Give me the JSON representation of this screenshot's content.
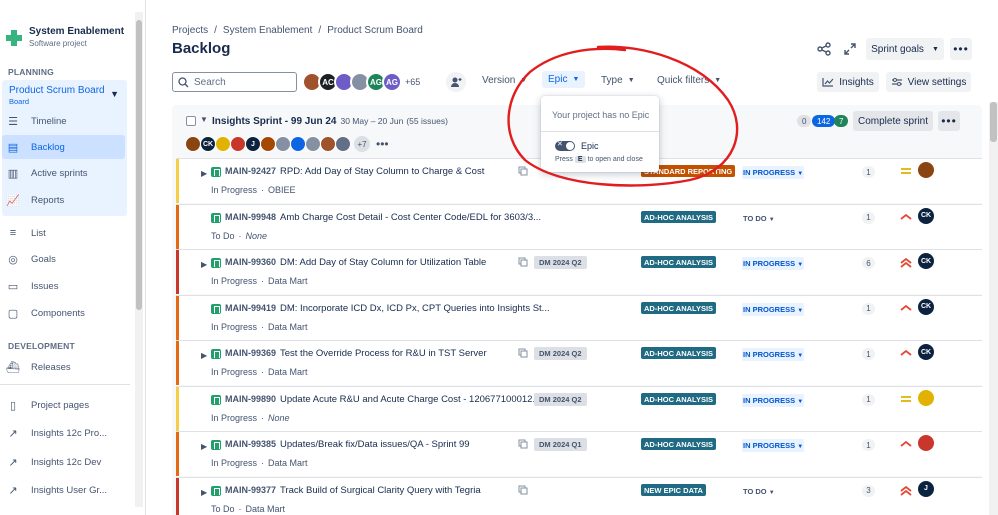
{
  "project": {
    "name": "System Enablement",
    "type": "Software project"
  },
  "sidebar": {
    "planning_heading": "PLANNING",
    "board": {
      "name": "Product Scrum Board",
      "sub": "Board"
    },
    "planning_items": [
      {
        "label": "Timeline",
        "icon": "timeline-icon"
      },
      {
        "label": "Backlog",
        "icon": "backlog-icon",
        "active": true
      },
      {
        "label": "Active sprints",
        "icon": "board-icon"
      },
      {
        "label": "Reports",
        "icon": "reports-icon"
      }
    ],
    "other_items": [
      {
        "label": "List",
        "icon": "list-icon"
      },
      {
        "label": "Goals",
        "icon": "goals-icon"
      },
      {
        "label": "Issues",
        "icon": "issues-icon"
      },
      {
        "label": "Components",
        "icon": "components-icon"
      }
    ],
    "development_heading": "DEVELOPMENT",
    "dev_items": [
      {
        "label": "Releases",
        "icon": "ship-icon"
      }
    ],
    "bottom_items": [
      {
        "label": "Project pages",
        "icon": "page-icon"
      },
      {
        "label": "Insights 12c Pro...",
        "icon": "external-link-icon"
      },
      {
        "label": "Insights 12c Dev",
        "icon": "external-link-icon"
      },
      {
        "label": "Insights User Gr...",
        "icon": "external-link-icon"
      }
    ]
  },
  "breadcrumbs": [
    "Projects",
    "System Enablement",
    "Product Scrum Board"
  ],
  "page_title": "Backlog",
  "header_buttons": {
    "sprint_goals": "Sprint goals"
  },
  "toolbar": {
    "search_placeholder": "Search",
    "avatars": [
      {
        "initials": "",
        "color": "#a0522d"
      },
      {
        "initials": "AC",
        "color": "#1d2125"
      },
      {
        "initials": "",
        "color": "#6e5dc6"
      },
      {
        "initials": "",
        "color": "#8590a2"
      },
      {
        "initials": "AG",
        "color": "#1f845a"
      },
      {
        "initials": "AG",
        "color": "#6e5dc6"
      }
    ],
    "avatar_overflow": "+65",
    "filters": [
      "Version",
      "Epic",
      "Type",
      "Quick filters"
    ],
    "insights": "Insights",
    "view_settings": "View settings"
  },
  "sprint": {
    "name": "Insights Sprint - 99 Jun 24",
    "dates": "30 May – 20 Jun",
    "count": "(55 issues)",
    "todo": "0",
    "in_progress": "142",
    "done": "7",
    "complete_label": "Complete sprint",
    "assignee_overflow": "+7",
    "assignees": [
      {
        "i": "",
        "c": "#8b4513"
      },
      {
        "i": "CK",
        "c": "#0c2340"
      },
      {
        "i": "",
        "c": "#e2b203"
      },
      {
        "i": "",
        "c": "#c9372c"
      },
      {
        "i": "J",
        "c": "#0c2340"
      },
      {
        "i": "",
        "c": "#a54800"
      },
      {
        "i": "",
        "c": "#8590a2"
      },
      {
        "i": "",
        "c": "#0c66e4"
      },
      {
        "i": "",
        "c": "#8590a2"
      },
      {
        "i": "",
        "c": "#a0522d"
      },
      {
        "i": "",
        "c": "#626f86"
      }
    ]
  },
  "issues": [
    {
      "key": "MAIN-92427",
      "summary": "RPD: Add Day of Stay Column to Charge & Cost",
      "status_label": "In Progress",
      "sub_label": "OBIEE",
      "italic": false,
      "expand": true,
      "child": true,
      "fix": "",
      "epic": "STANDARD REPORTING",
      "epic_color": "#c25100",
      "status": "IN PROGRESS",
      "pts": "1",
      "priority": "medium",
      "avatar": "",
      "avatar_color": "#8b4513",
      "bar": "#f5cd47"
    },
    {
      "key": "MAIN-99948",
      "summary": "Amb Charge Cost Detail - Cost Center Code/EDL for 3603/3...",
      "status_label": "To Do",
      "sub_label": "None",
      "italic": true,
      "expand": false,
      "child": false,
      "fix": "",
      "epic": "AD-HOC ANALYSIS",
      "epic_color": "#206a83",
      "status": "TO DO",
      "pts": "1",
      "priority": "high",
      "avatar": "CK",
      "avatar_color": "#0c2340",
      "bar": "#e56910"
    },
    {
      "key": "MAIN-99360",
      "summary": "DM: Add Day of Stay Column for Utilization Table",
      "status_label": "In Progress",
      "sub_label": "Data Mart",
      "italic": false,
      "expand": true,
      "child": true,
      "fix": "DM 2024 Q2",
      "epic": "AD-HOC ANALYSIS",
      "epic_color": "#206a83",
      "status": "IN PROGRESS",
      "pts": "6",
      "priority": "highest",
      "avatar": "CK",
      "avatar_color": "#0c2340",
      "bar": "#c9372c"
    },
    {
      "key": "MAIN-99419",
      "summary": "DM: Incorporate ICD Dx, ICD Px, CPT Queries into Insights St...",
      "status_label": "In Progress",
      "sub_label": "Data Mart",
      "italic": false,
      "expand": false,
      "child": false,
      "fix": "",
      "epic": "AD-HOC ANALYSIS",
      "epic_color": "#206a83",
      "status": "IN PROGRESS",
      "pts": "1",
      "priority": "high",
      "avatar": "CK",
      "avatar_color": "#0c2340",
      "bar": "#e56910"
    },
    {
      "key": "MAIN-99369",
      "summary": "Test the Override Process for R&U in TST Server",
      "status_label": "In Progress",
      "sub_label": "Data Mart",
      "italic": false,
      "expand": true,
      "child": true,
      "fix": "DM 2024 Q2",
      "epic": "AD-HOC ANALYSIS",
      "epic_color": "#206a83",
      "status": "IN PROGRESS",
      "pts": "1",
      "priority": "high",
      "avatar": "CK",
      "avatar_color": "#0c2340",
      "bar": "#e56910"
    },
    {
      "key": "MAIN-99890",
      "summary": "Update Acute R&U and Acute Charge Cost - 120677100012...",
      "status_label": "In Progress",
      "sub_label": "None",
      "italic": true,
      "expand": false,
      "child": false,
      "fix": "DM 2024 Q2",
      "epic": "AD-HOC ANALYSIS",
      "epic_color": "#206a83",
      "status": "IN PROGRESS",
      "pts": "1",
      "priority": "medium",
      "avatar": "",
      "avatar_color": "#e2b203",
      "bar": "#f5cd47"
    },
    {
      "key": "MAIN-99385",
      "summary": "Updates/Break fix/Data issues/QA - Sprint 99",
      "status_label": "In Progress",
      "sub_label": "Data Mart",
      "italic": false,
      "expand": true,
      "child": true,
      "fix": "DM 2024 Q1",
      "epic": "AD-HOC ANALYSIS",
      "epic_color": "#206a83",
      "status": "IN PROGRESS",
      "pts": "1",
      "priority": "high",
      "avatar": "",
      "avatar_color": "#c9372c",
      "bar": "#e56910"
    },
    {
      "key": "MAIN-99377",
      "summary": "Track Build of Surgical Clarity Query with Tegria",
      "status_label": "To Do",
      "sub_label": "Data Mart",
      "italic": false,
      "expand": true,
      "child": true,
      "fix": "",
      "epic": "NEW EPIC DATA",
      "epic_color": "#206a83",
      "status": "TO DO",
      "pts": "3",
      "priority": "highest",
      "avatar": "J",
      "avatar_color": "#0c2340",
      "bar": "#c9372c"
    }
  ],
  "epic_dropdown": {
    "empty": "Your project has no Epic",
    "toggle_label": "Epic",
    "hint_pre": "Press",
    "hint_key": "E",
    "hint_post": "to open and close"
  },
  "colors": {
    "accent": "#0c66e4",
    "annotation": "#e11d1d"
  }
}
